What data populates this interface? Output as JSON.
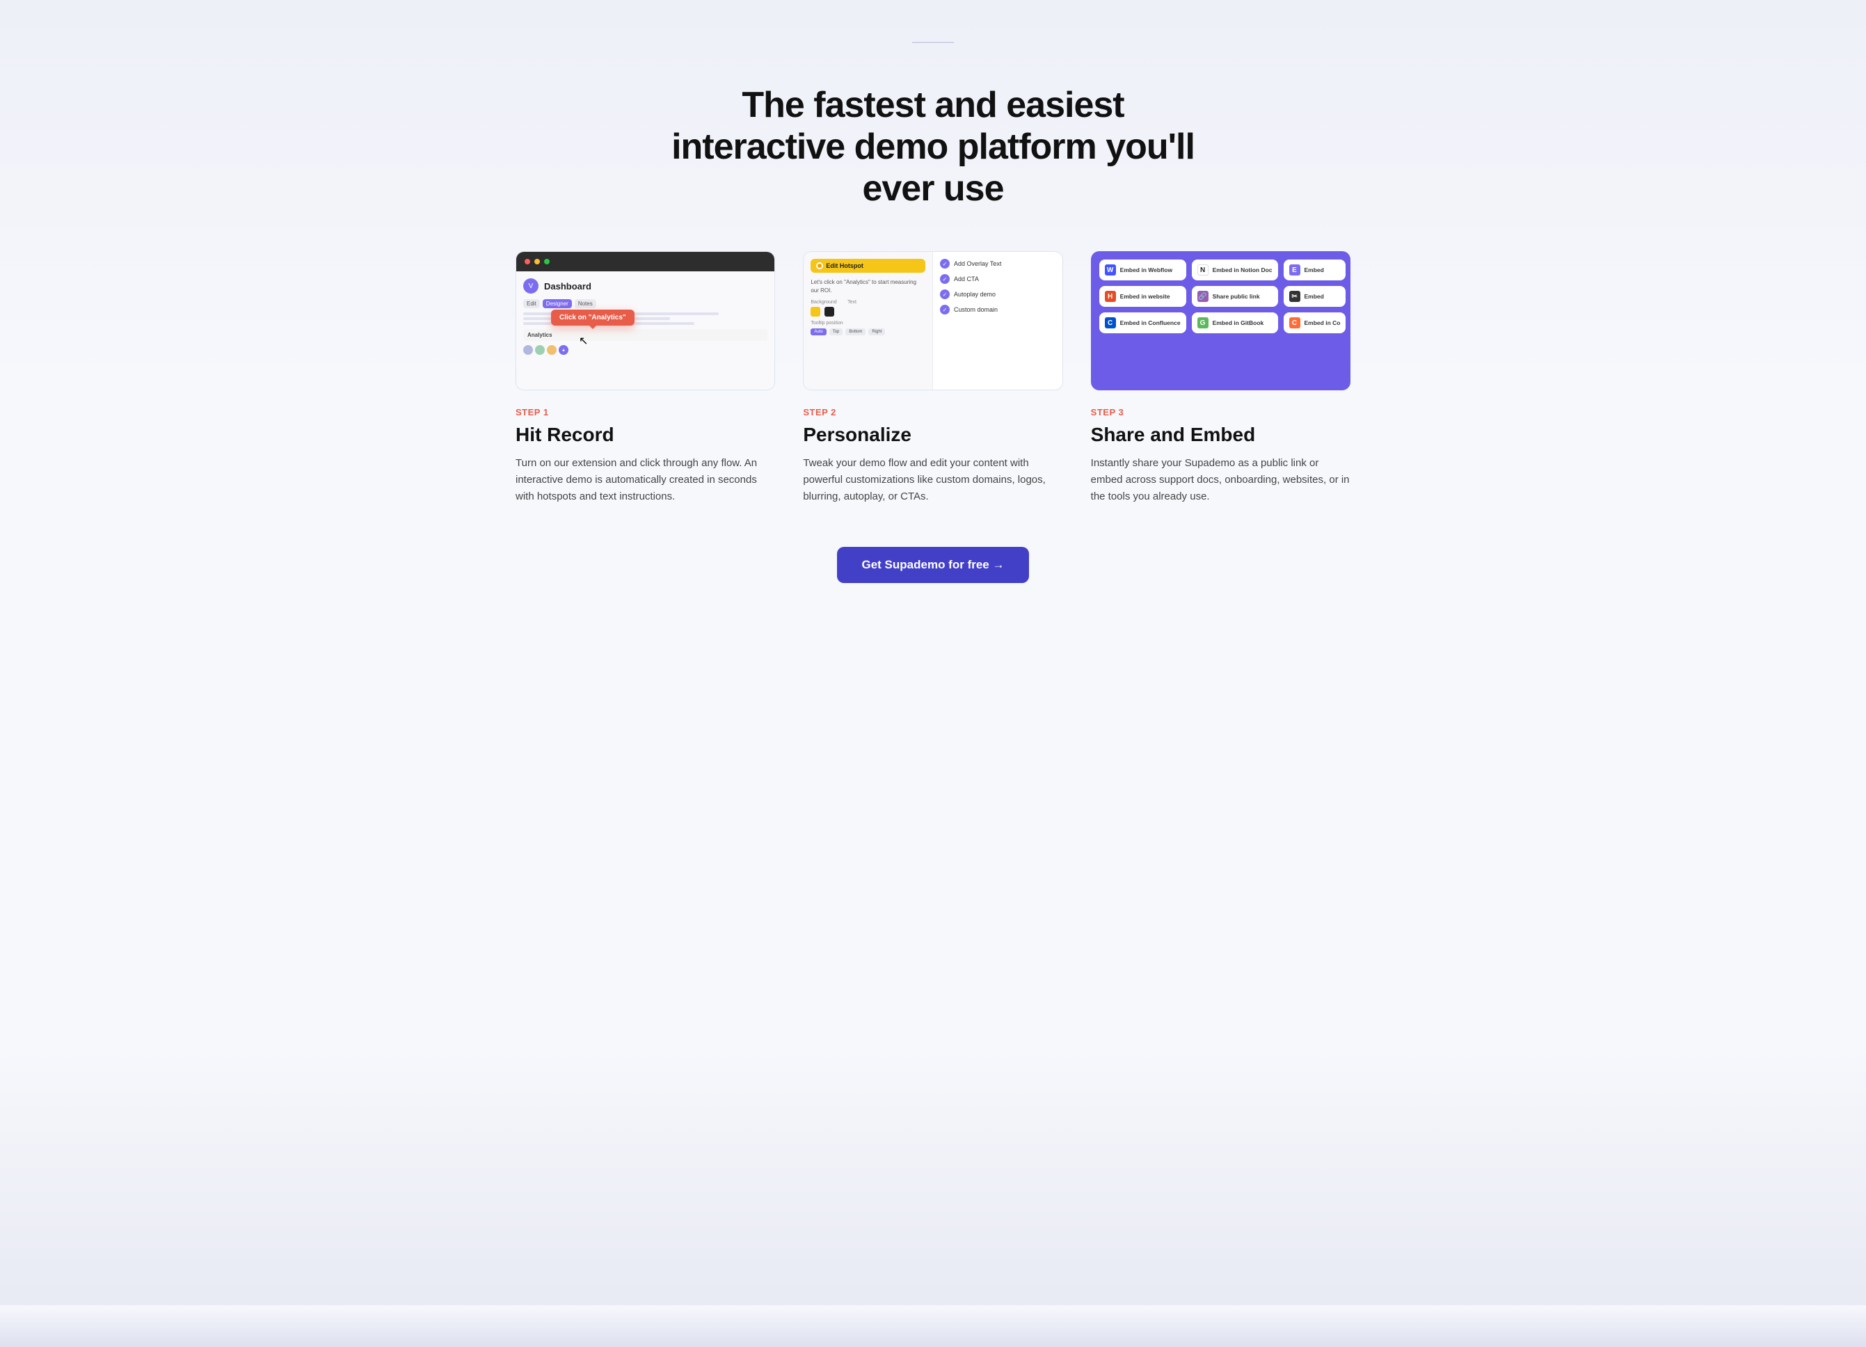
{
  "hero": {
    "title": "The fastest and easiest interactive demo platform you'll ever use"
  },
  "steps": [
    {
      "id": "step1",
      "label": "STEP 1",
      "title": "Hit Record",
      "desc": "Turn on our extension and click through any flow. An interactive demo is automatically created in seconds with hotspots and text instructions.",
      "tooltip_text": "Click on \"Analytics\"",
      "dashboard_title": "Dashboard"
    },
    {
      "id": "step2",
      "label": "STEP 2",
      "title": "Personalize",
      "desc": "Tweak your demo flow and edit your content with powerful customizations like custom domains, logos, blurring, autoplay, or CTAs.",
      "edit_header": "Edit Hotspot",
      "edit_desc": "Let's click on \"Analytics\" to start measuring our ROI.",
      "options": [
        "Add Overlay Text",
        "Add CTA",
        "Autoplay demo",
        "Custom domain"
      ]
    },
    {
      "id": "step3",
      "label": "STEP 3",
      "title": "Share and Embed",
      "desc": "Instantly share your Supademo as a public link or embed across support docs, onboarding, websites, or in the tools you already use.",
      "embed_options": [
        {
          "icon": "W",
          "icon_class": "webflow",
          "label": "Embed in Webflow"
        },
        {
          "icon": "N",
          "icon_class": "notion",
          "label": "Embed in Notion Doc"
        },
        {
          "icon": "E",
          "icon_class": "plain",
          "label": "Embed"
        },
        {
          "icon": "H",
          "icon_class": "html5",
          "label": "Embed in website"
        },
        {
          "icon": "🔗",
          "icon_class": "link",
          "label": "Share public link"
        },
        {
          "icon": "✂",
          "icon_class": "cut",
          "label": "Embed"
        },
        {
          "icon": "C",
          "icon_class": "confluence",
          "label": "Embed in Confluence"
        },
        {
          "icon": "G",
          "icon_class": "gitbook",
          "label": "Embed in GitBook"
        },
        {
          "icon": "C",
          "icon_class": "confluence2",
          "label": "Embed in Co"
        }
      ]
    }
  ],
  "cta": {
    "label": "Get Supademo for free →"
  }
}
